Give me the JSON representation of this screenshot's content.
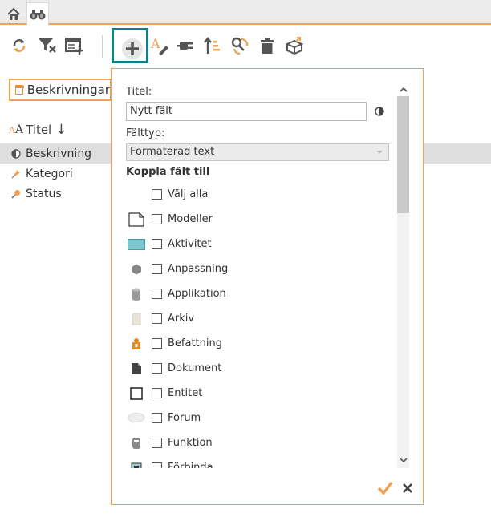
{
  "toolbar": {
    "icons": [
      "refresh-icon",
      "filter-clear-icon",
      "add-column-icon",
      "add-field-icon",
      "rename-icon",
      "plugin-icon",
      "sort-icon",
      "link-icon",
      "delete-icon",
      "export-icon"
    ]
  },
  "left": {
    "dropdown_label": "Beskrivningar",
    "sort_header": "Titel",
    "fields": [
      {
        "label": "Beskrivning",
        "selected": true
      },
      {
        "label": "Kategori",
        "selected": false
      },
      {
        "label": "Status",
        "selected": false
      }
    ]
  },
  "popup": {
    "title_label": "Titel:",
    "title_value": "Nytt fält",
    "type_label": "Fälttyp:",
    "type_value": "Formaterad text",
    "link_header": "Koppla fält till",
    "items": [
      {
        "label": "Välj alla",
        "icon": ""
      },
      {
        "label": "Modeller",
        "icon": "document-icon"
      },
      {
        "label": "Aktivitet",
        "icon": "activity-icon"
      },
      {
        "label": "Anpassning",
        "icon": "hexagon-icon"
      },
      {
        "label": "Applikation",
        "icon": "cylinder-icon"
      },
      {
        "label": "Arkiv",
        "icon": "archive-icon"
      },
      {
        "label": "Befattning",
        "icon": "position-icon"
      },
      {
        "label": "Dokument",
        "icon": "document-filled-icon"
      },
      {
        "label": "Entitet",
        "icon": "entity-icon"
      },
      {
        "label": "Forum",
        "icon": "forum-icon"
      },
      {
        "label": "Funktion",
        "icon": "function-icon"
      },
      {
        "label": "Förbinda",
        "icon": "connect-icon"
      }
    ]
  },
  "colors": {
    "accent": "#f0a050",
    "teal": "#0d8189",
    "selected_row": "#dedede"
  }
}
